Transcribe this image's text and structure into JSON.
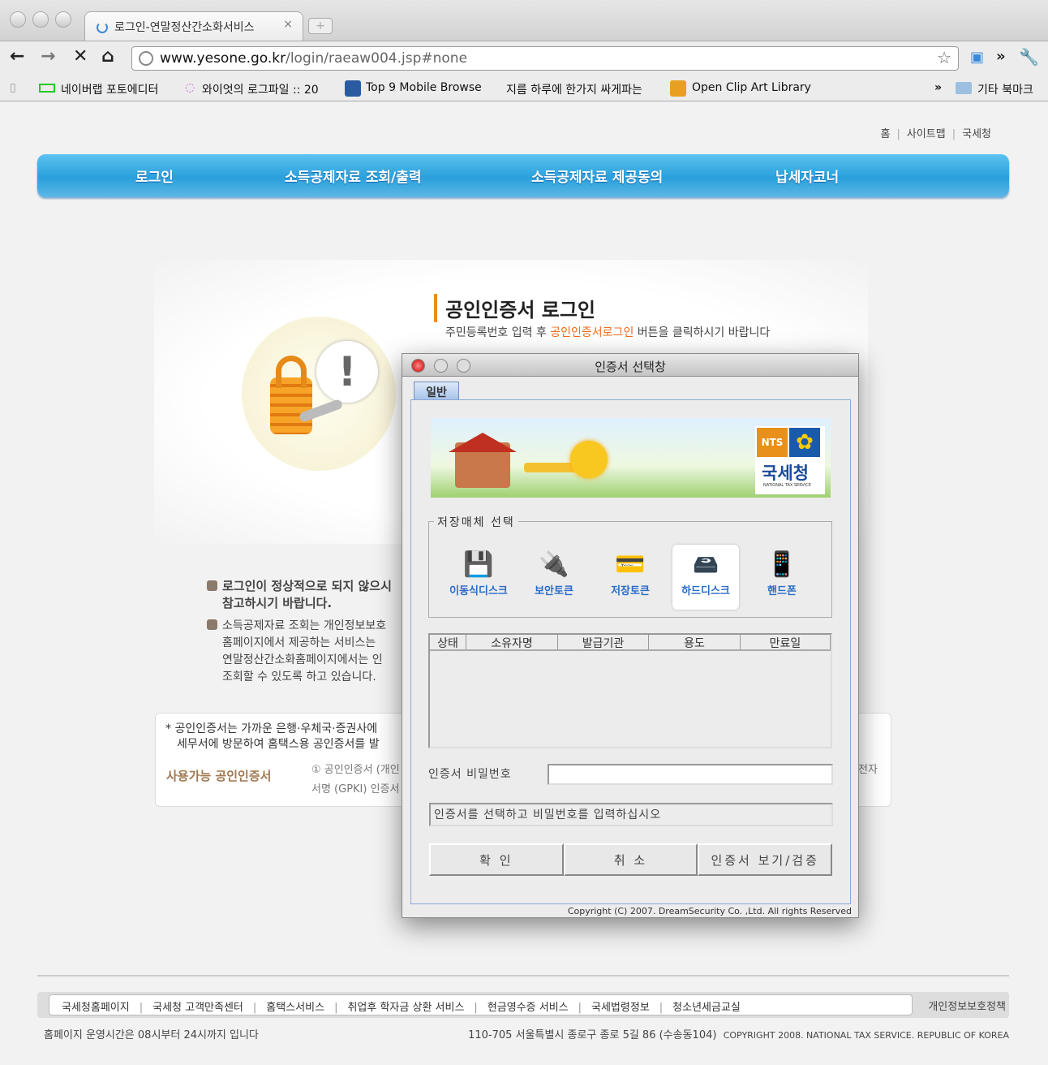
{
  "browser": {
    "tab_title": "로그인-연말정산간소화서비스",
    "tab_close": "×",
    "new_tab": "+",
    "url_host": "www.yesone.go.kr",
    "url_path": "/login/raeaw004.jsp#none",
    "bookmarks": [
      "네이버랩 포토에디터",
      "와이엇의 로그파일 :: 20",
      "Top 9 Mobile Browse",
      "지름 하루에 한가지 싸게파는",
      "Open Clip Art Library"
    ],
    "bookmarks_overflow": "»",
    "other_bookmarks": "기타 북마크"
  },
  "top_links": [
    "홈",
    "사이트맵",
    "국세청"
  ],
  "nav": [
    "로그인",
    "소득공제자료 조회/출력",
    "소득공제자료 제공동의",
    "납세자코너"
  ],
  "login": {
    "title": "공인인증서 로그인",
    "subtitle_pre": "주민등록번호 입력 후 ",
    "subtitle_hl": "공인인증서로그인",
    "subtitle_post": " 버튼을 클릭하시기 바랍니다"
  },
  "bullets": [
    [
      "로그인이 정상적으로 되지 않으시",
      "참고하시기 바랍니다."
    ],
    [
      "소득공제자료 조회는 개인정보보호",
      "홈페이지에서 제공하는 서비스는 ",
      "연말정산간소화홈페이지에서는 인",
      "조회할 수 있도록 하고 있습니다."
    ]
  ],
  "info": {
    "line1": "* 공인인증서는 가까운 은행·우체국·증권사에",
    "line2": "세무서에 방문하여 홈택스용 공인증서를 발",
    "label": "사용가능 공인인증서",
    "item1": "① 공인인증서 (개인",
    "item2": "서명 (GPKI) 인증서",
    "right": "전자"
  },
  "dialog": {
    "title": "인증서 선택창",
    "tab": "일반",
    "banner_logo": "NTS",
    "banner_org": "국세청",
    "banner_org_en": "NATIONAL TAX SERVICE",
    "group_label": "저장매체 선택",
    "media": [
      {
        "label": "이동식디스크",
        "icon": "floppy-usb-icon"
      },
      {
        "label": "보안토큰",
        "icon": "security-token-icon"
      },
      {
        "label": "저장토큰",
        "icon": "smart-card-icon"
      },
      {
        "label": "하드디스크",
        "icon": "hard-disk-icon",
        "selected": true
      },
      {
        "label": "핸드폰",
        "icon": "phone-icon"
      }
    ],
    "columns": [
      "상태",
      "소유자명",
      "발급기관",
      "용도",
      "만료일"
    ],
    "password_label": "인증서 비밀번호",
    "password_value": "",
    "status": "인증서를 선택하고 비밀번호를 입력하십시오",
    "buttons": [
      "확 인",
      "취 소",
      "인증서 보기/검증"
    ],
    "copyright": "Copyright (C) 2007. DreamSecurity Co. ,Ltd. All rights Reserved"
  },
  "footer": {
    "links": [
      "국세청홈페이지",
      "국세청 고객만족센터",
      "홈택스서비스",
      "취업후 학자금 상환 서비스",
      "현금영수증 서비스",
      "국세법령정보",
      "청소년세금교실"
    ],
    "privacy": "개인정보보호정책",
    "hours": "홈페이지 운영시간은 08시부터 24시까지 입니다",
    "address": "110-705 서울특별시 종로구 종로 5길 86 (수송동104)",
    "copyright": "COPYRIGHT 2008. NATIONAL TAX SERVICE. REPUBLIC OF KOREA"
  },
  "colors": {
    "nav": "#2a9fdc",
    "accent": "#f06a1e",
    "media_label": "#2a6cc8"
  }
}
